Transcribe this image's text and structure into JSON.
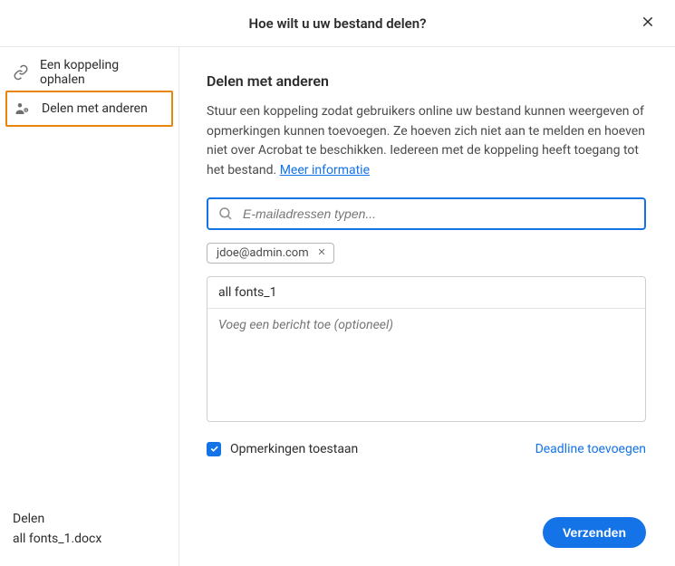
{
  "header": {
    "title": "Hoe wilt u uw bestand delen?"
  },
  "sidebar": {
    "items": [
      {
        "label": "Een koppeling ophalen",
        "selected": false
      },
      {
        "label": "Delen met anderen",
        "selected": true
      }
    ],
    "footer": {
      "label": "Delen",
      "filename": "all fonts_1.docx"
    }
  },
  "main": {
    "title": "Delen met anderen",
    "description": "Stuur een koppeling zodat gebruikers online uw bestand kunnen weergeven of opmerkingen kunnen toevoegen. Ze hoeven zich niet aan te melden en hoeven niet over Acrobat te beschikken. Iedereen met de koppeling heeft toegang tot het bestand. ",
    "moreInfoLabel": "Meer informatie",
    "emailPlaceholder": "E-mailadressen typen...",
    "chips": [
      {
        "email": "jdoe@admin.com"
      }
    ],
    "filename": "all fonts_1",
    "messagePlaceholder": "Voeg een bericht toe (optioneel)",
    "allowCommentsLabel": "Opmerkingen toestaan",
    "allowCommentsChecked": true,
    "deadlineLabel": "Deadline toevoegen",
    "sendLabel": "Verzenden"
  }
}
